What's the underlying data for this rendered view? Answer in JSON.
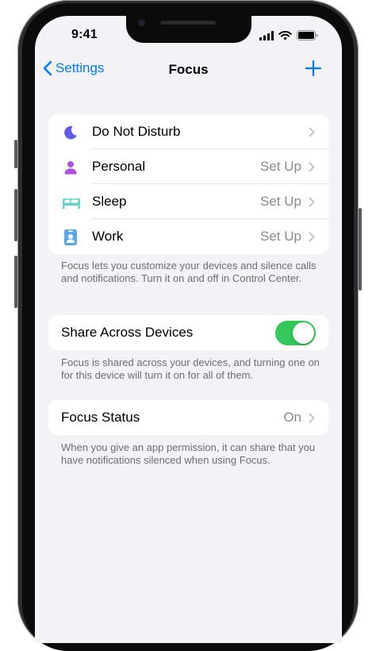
{
  "status_bar": {
    "time": "9:41"
  },
  "nav": {
    "back_label": "Settings",
    "title": "Focus"
  },
  "focus_modes": [
    {
      "label": "Do Not Disturb",
      "value": "",
      "icon": "moon-icon",
      "color": "#5e5ce6"
    },
    {
      "label": "Personal",
      "value": "Set Up",
      "icon": "person-icon",
      "color": "#af52de"
    },
    {
      "label": "Sleep",
      "value": "Set Up",
      "icon": "bed-icon",
      "color": "#64d2c6"
    },
    {
      "label": "Work",
      "value": "Set Up",
      "icon": "id-badge-icon",
      "color": "#5aa8e8"
    }
  ],
  "focus_footer": "Focus lets you customize your devices and silence calls and notifications. Turn it on and off in Control Center.",
  "share": {
    "label": "Share Across Devices",
    "enabled": true,
    "footer": "Focus is shared across your devices, and turning one on for this device will turn it on for all of them."
  },
  "focus_status": {
    "label": "Focus Status",
    "value": "On",
    "footer": "When you give an app permission, it can share that you have notifications silenced when using Focus."
  },
  "colors": {
    "accent": "#007aff",
    "toggle_on": "#34c759",
    "background": "#f2f2f7"
  }
}
